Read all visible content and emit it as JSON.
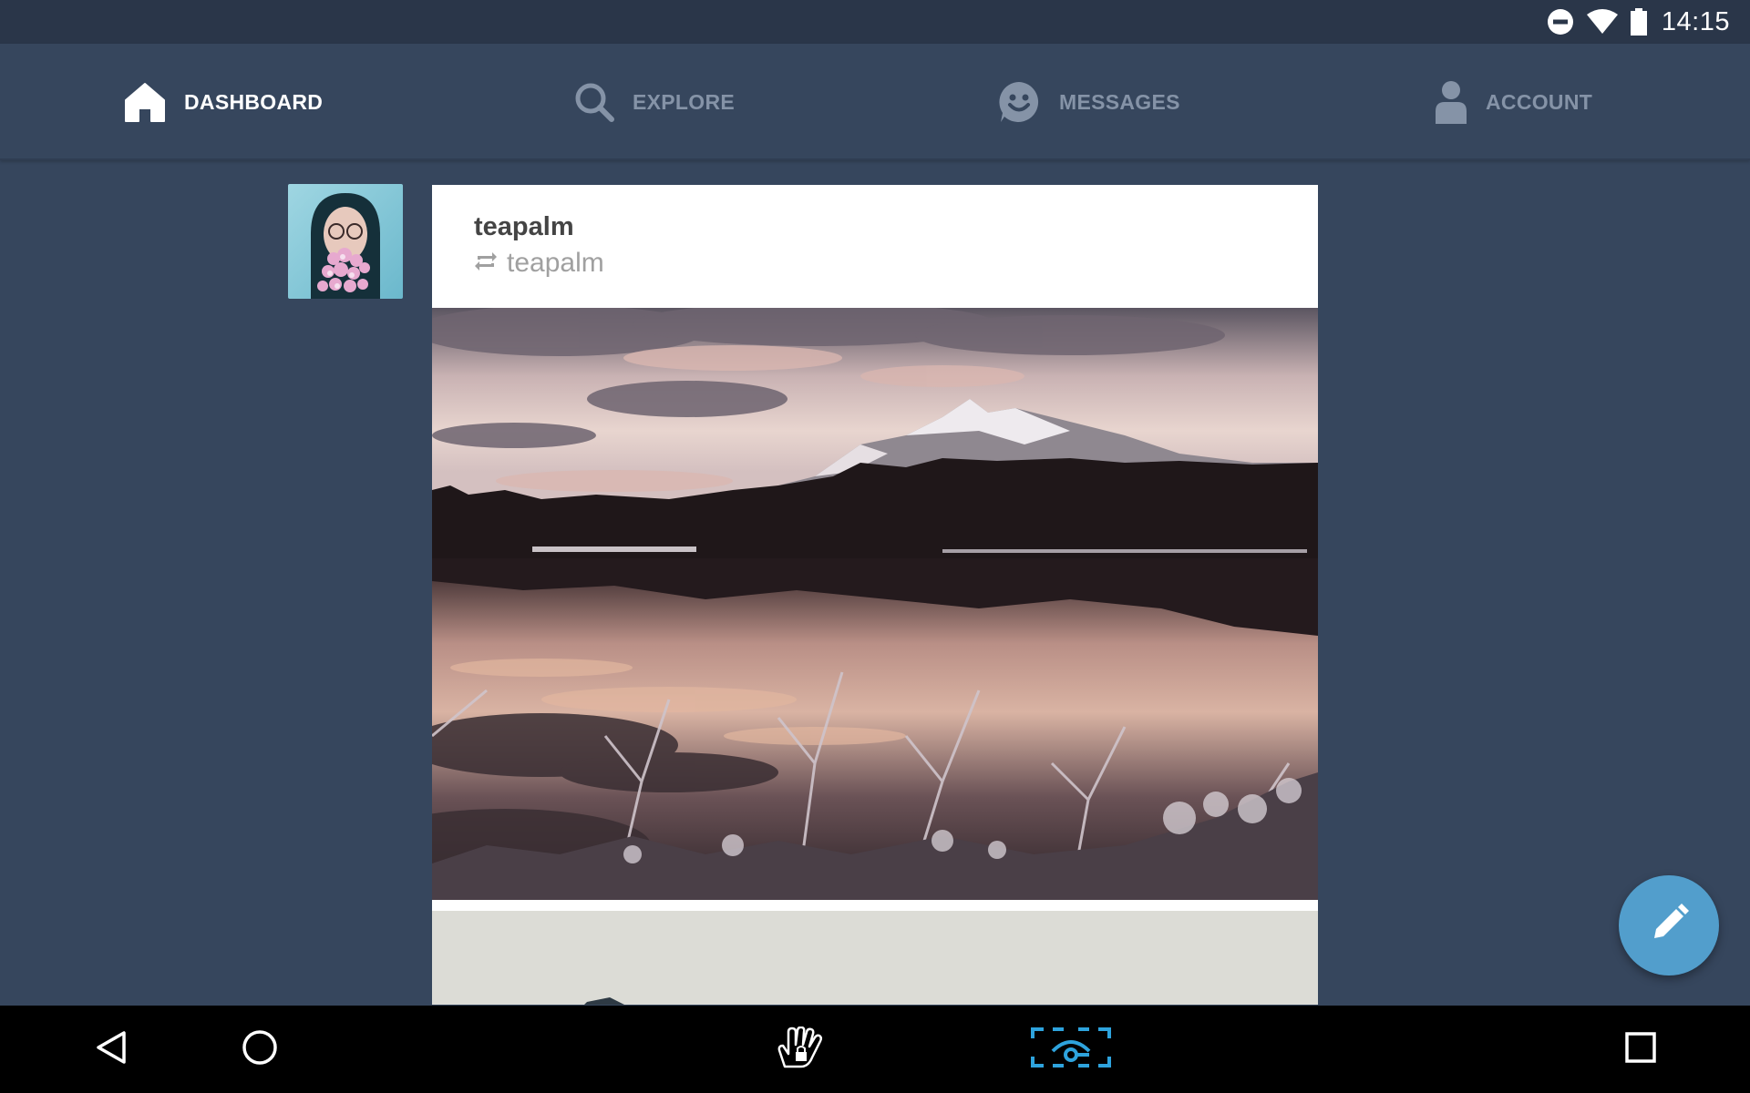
{
  "status_bar": {
    "time": "14:15",
    "icons": [
      "do-not-disturb-icon",
      "wifi-icon",
      "battery-icon"
    ]
  },
  "nav": {
    "tabs": [
      {
        "label": "DASHBOARD",
        "icon": "home-icon",
        "active": true
      },
      {
        "label": "EXPLORE",
        "icon": "search-icon",
        "active": false
      },
      {
        "label": "MESSAGES",
        "icon": "smiley-chat-icon",
        "active": false
      },
      {
        "label": "ACCOUNT",
        "icon": "person-icon",
        "active": false
      }
    ]
  },
  "post": {
    "author": "teapalm",
    "reblog_source": "teapalm",
    "reblog_icon": "reblog-icon",
    "photos": [
      "mountain-lake-sunset-photo",
      "second-photo-partial"
    ]
  },
  "fab": {
    "icon": "pencil-icon"
  },
  "system_nav": {
    "buttons": [
      "back-icon",
      "home-circle-icon",
      "touch-lock-icon",
      "screen-capture-icon",
      "recents-icon"
    ]
  },
  "colors": {
    "background": "#36465d",
    "status_bar": "#2a3649",
    "active_tab": "#ffffff",
    "inactive_tab": "#8593a7",
    "fab": "#529ecc",
    "capture_accent": "#2ea3dd"
  }
}
